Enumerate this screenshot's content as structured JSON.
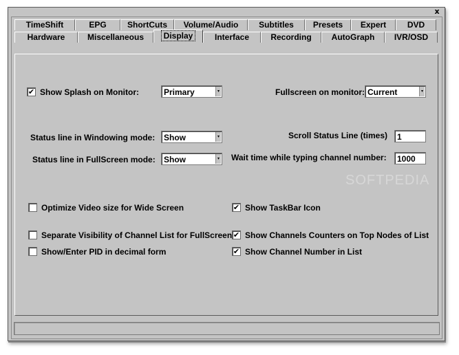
{
  "window": {
    "close_glyph": "x"
  },
  "tabs_row1": [
    {
      "label": "TimeShift"
    },
    {
      "label": "EPG"
    },
    {
      "label": "ShortCuts"
    },
    {
      "label": "Volume/Audio"
    },
    {
      "label": "Subtitles"
    },
    {
      "label": "Presets"
    },
    {
      "label": "Expert"
    },
    {
      "label": "DVD"
    }
  ],
  "tabs_row2": [
    {
      "label": "Hardware"
    },
    {
      "label": "Miscellaneous"
    },
    {
      "label": "Display",
      "active": true
    },
    {
      "label": "Interface"
    },
    {
      "label": "Recording"
    },
    {
      "label": "AutoGraph"
    },
    {
      "label": "IVR/OSD"
    }
  ],
  "display": {
    "splash": {
      "label": "Show Splash on Monitor:",
      "checked": true,
      "value": "Primary"
    },
    "fullscreen_monitor": {
      "label": "Fullscreen on monitor:",
      "value": "Current"
    },
    "status_windowing": {
      "label": "Status line in Windowing mode:",
      "value": "Show"
    },
    "status_fullscreen": {
      "label": "Status line in FullScreen mode:",
      "value": "Show"
    },
    "scroll_status": {
      "label": "Scroll Status Line (times)",
      "value": "1"
    },
    "wait_time": {
      "label": "Wait time while typing channel number:",
      "value": "1000"
    },
    "checkboxes_left": [
      {
        "label": "Optimize Video size for Wide Screen",
        "checked": false
      },
      {
        "label": "Separate Visibility of Channel List for FullScreen",
        "checked": false
      },
      {
        "label": "Show/Enter PID in decimal form",
        "checked": false
      }
    ],
    "checkboxes_right": [
      {
        "label": "Show TaskBar Icon",
        "checked": true
      },
      {
        "label": "Show Channels Counters on Top Nodes of List",
        "checked": true
      },
      {
        "label": "Show Channel Number in List",
        "checked": true
      }
    ]
  },
  "watermark": "SOFTPEDIA",
  "check_glyph": "✔",
  "arrow_glyph": "▾"
}
